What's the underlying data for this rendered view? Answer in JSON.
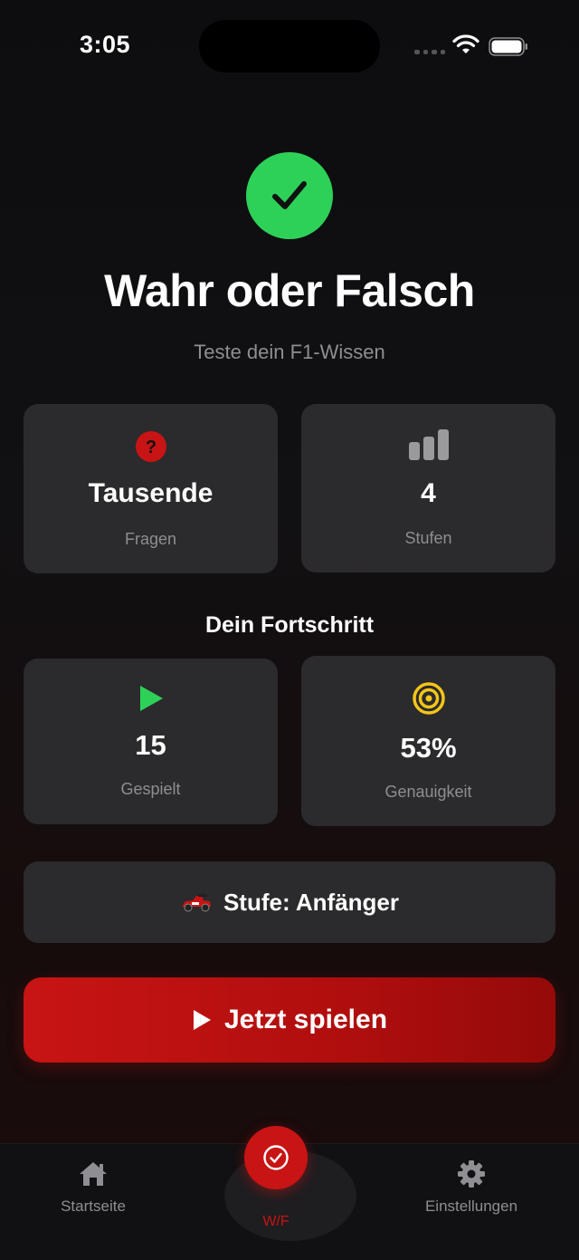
{
  "status_bar": {
    "time": "3:05"
  },
  "hero": {
    "icon": "checkmark-icon",
    "title": "Wahr oder Falsch",
    "subtitle": "Teste dein F1-Wissen"
  },
  "info_cards": [
    {
      "icon": "question-icon",
      "value": "Tausende",
      "label": "Fragen"
    },
    {
      "icon": "bar-chart-icon",
      "value": "4",
      "label": "Stufen"
    }
  ],
  "progress": {
    "title": "Dein Fortschritt",
    "cards": [
      {
        "icon": "play-icon",
        "value": "15",
        "label": "Gespielt"
      },
      {
        "icon": "target-icon",
        "value": "53%",
        "label": "Genauigkeit"
      }
    ]
  },
  "level": {
    "icon": "race-car-icon",
    "label": "Stufe: Anfänger"
  },
  "play_button": {
    "label": "Jetzt spielen"
  },
  "tabbar": {
    "items": [
      {
        "icon": "home-icon",
        "label": "Startseite"
      },
      {
        "icon": "checkmark-circle-icon",
        "label": "W/F"
      },
      {
        "icon": "gear-icon",
        "label": "Einstellungen"
      }
    ]
  },
  "colors": {
    "accent_red": "#c81414",
    "success_green": "#2ed158",
    "target_yellow": "#f5c518",
    "card_bg": "#2b2a2c"
  }
}
